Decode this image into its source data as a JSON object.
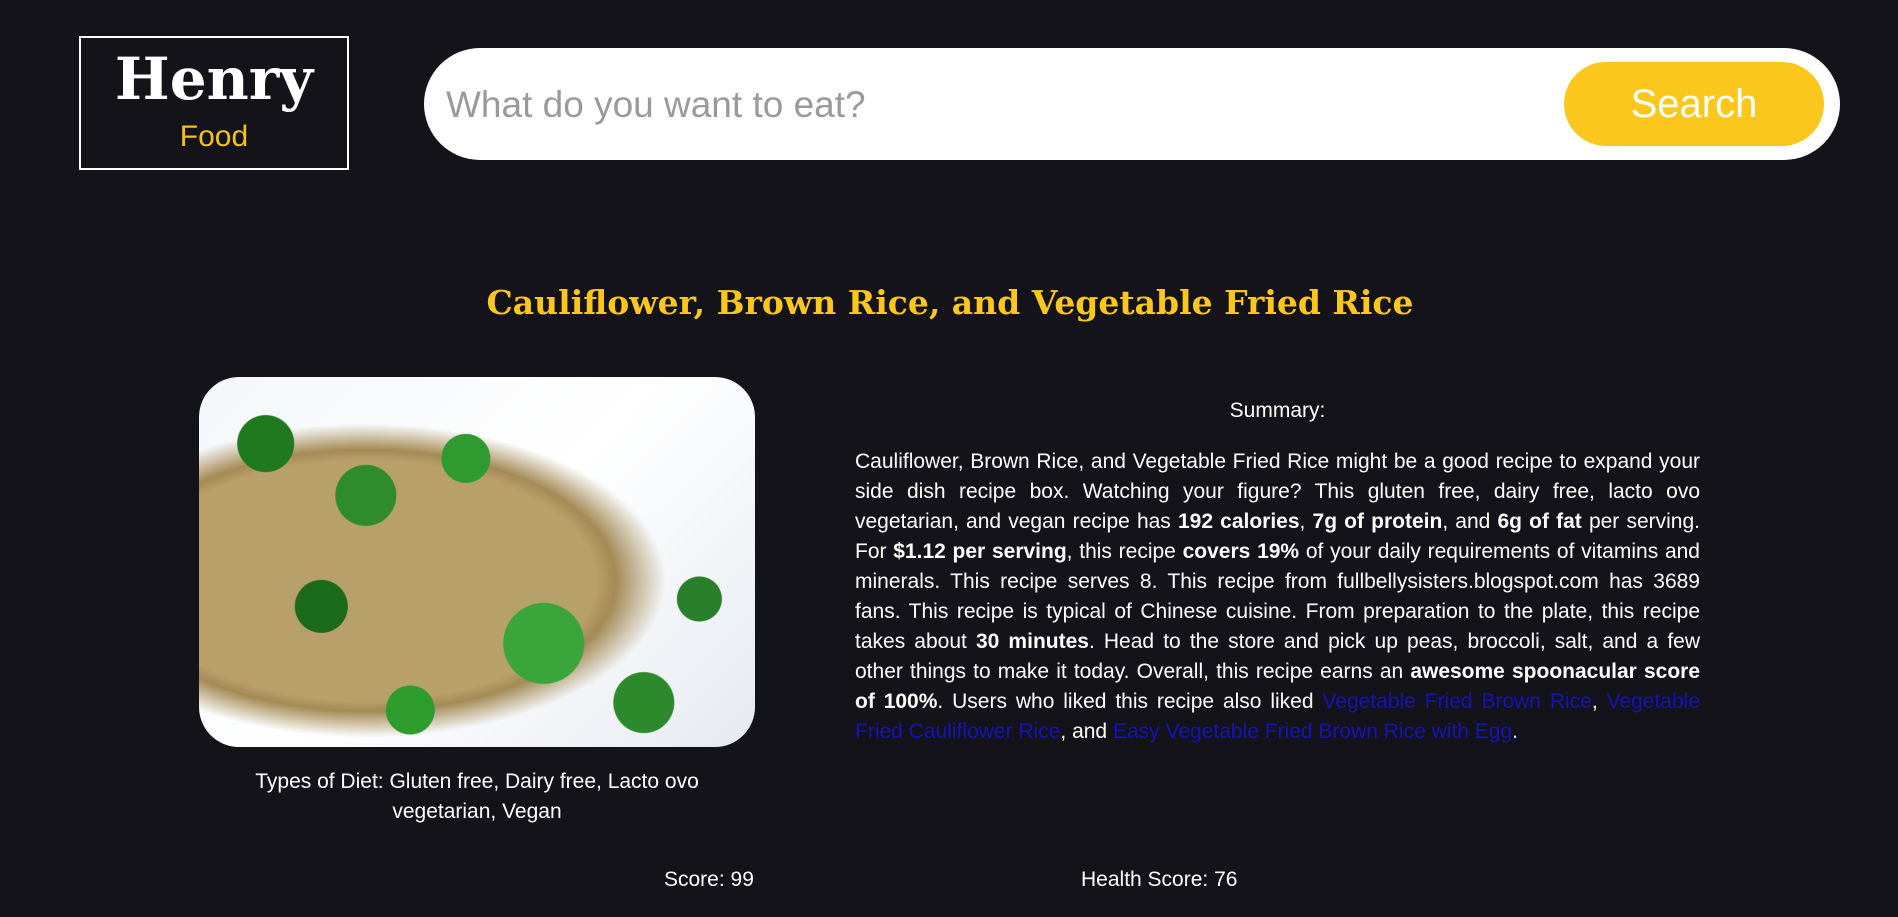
{
  "header": {
    "logo_title": "Henry",
    "logo_subtitle": "Food",
    "search_placeholder": "What do you want to eat?",
    "search_button": "Search"
  },
  "recipe": {
    "title": "Cauliflower, Brown Rice, and Vegetable Fried Rice",
    "diet_types": "Types of Diet: Gluten free, Dairy free, Lacto ovo vegetarian, Vegan",
    "summary_label": "Summary:",
    "summary": {
      "t1": "Cauliflower, Brown Rice, and Vegetable Fried Rice might be a good recipe to expand your side dish recipe box. Watching your figure? This gluten free, dairy free, lacto ovo vegetarian, and vegan recipe has ",
      "b1": "192 calories",
      "t2": ", ",
      "b2": "7g of protein",
      "t3": ", and ",
      "b3": "6g of fat",
      "t4": " per serving. For ",
      "b4": "$1.12 per serving",
      "t5": ", this recipe ",
      "b5": "covers 19%",
      "t6": " of your daily requirements of vitamins and minerals. This recipe serves 8. This recipe from fullbellysisters.blogspot.com has 3689 fans. This recipe is typical of Chinese cuisine. From preparation to the plate, this recipe takes about ",
      "b6": "30 minutes",
      "t7": ". Head to the store and pick up peas, broccoli, salt, and a few other things to make it today. Overall, this recipe earns an ",
      "b7": "awesome spoonacular score of 100%",
      "t8": ". Users who liked this recipe also liked ",
      "link1": "Vegetable Fried Brown Rice",
      "t9": ", ",
      "link2": "Vegetable Fried Cauliflower Rice",
      "t10": ", and ",
      "link3": "Easy Vegetable Fried Brown Rice with Egg",
      "t11": "."
    },
    "score": "Score: 99",
    "health_score": "Health Score: 76"
  },
  "colors": {
    "background": "#131319",
    "accent": "#fcc71d",
    "link": "#1414b8"
  }
}
